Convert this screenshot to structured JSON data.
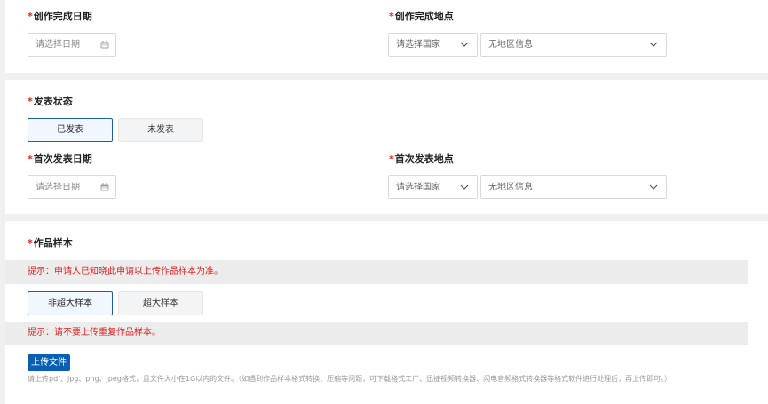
{
  "required_mark": "*",
  "creation": {
    "date_label": "创作完成日期",
    "date_placeholder": "请选择日期",
    "place_label": "创作完成地点",
    "country_placeholder": "请选择国家",
    "region_placeholder": "无地区信息"
  },
  "publish_status": {
    "label": "发表状态",
    "options": [
      "已发表",
      "未发表"
    ],
    "selected": "已发表"
  },
  "first_publish": {
    "date_label": "首次发表日期",
    "date_placeholder": "请选择日期",
    "place_label": "首次发表地点",
    "country_placeholder": "请选择国家",
    "region_placeholder": "无地区信息"
  },
  "sample": {
    "label": "作品样本",
    "notice1": "提示：申请人已知晓此申请以上传作品样本为准。",
    "options": [
      "非超大样本",
      "超大样本"
    ],
    "selected": "非超大样本",
    "notice2": "提示：请不要上传重复作品样本。",
    "upload_label": "上传文件",
    "hint": "请上传pdf、jpg、png、jpeg格式，且文件大小在1G以内的文件。（如遇到作品样本格式转换、压缩等问题，可下载格式工厂、迅捷视频转换器、闪电音频格式转换器等格式软件进行处理后，再上传即可。）"
  },
  "colors": {
    "required": "#e02020",
    "primary": "#0b5fb3",
    "active_border": "#1c5ea8",
    "notice_text": "#e02020",
    "notice_bg": "#ececec"
  },
  "icons": {
    "calendar": "calendar-icon",
    "dropdown": "chevron-down-icon"
  }
}
